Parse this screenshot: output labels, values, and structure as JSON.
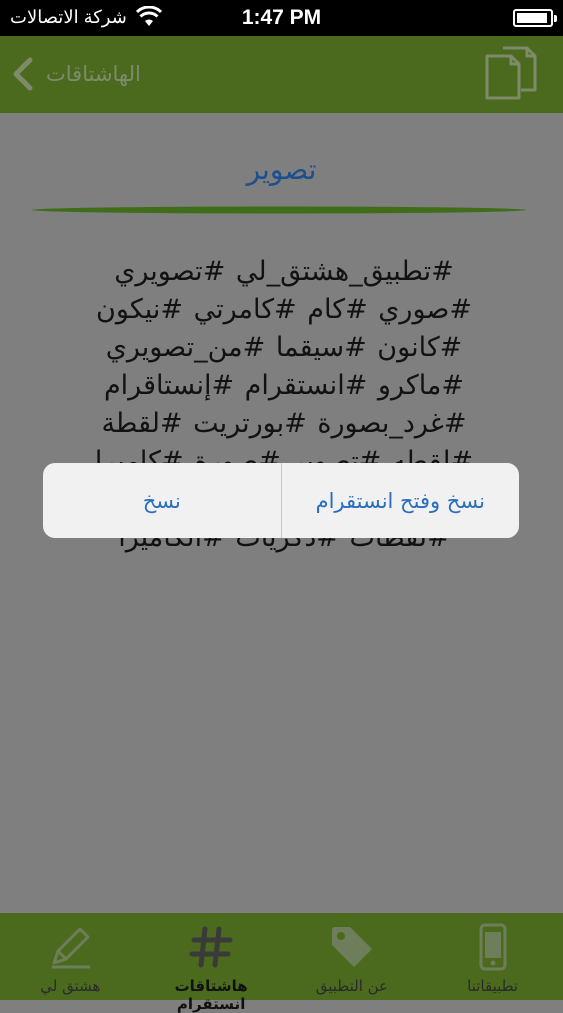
{
  "status_bar": {
    "carrier": "شركة الاتصالات",
    "time": "1:47 PM",
    "battery_level": 0.95
  },
  "nav_bar": {
    "back_label": "الهاشتاقات",
    "action_icon": "copy-icon"
  },
  "page": {
    "title": "تصوير",
    "hashtags": "#تطبيق_هشتق_لي #تصويري #صوري #كام #كامرتي #نيكون #كانون #سيقما #من_تصويري #ماكرو #انستقرام #إنستاقرام #غرد_بصورة #بورتريت #لقطة #لقطه #تصوير #صورة #كاميرا #عدستي #عدسة #فوتوغرافي #لقطات #ذكريات #الكاميرا"
  },
  "action_sheet": {
    "copy_open_label": "نسخ وفتح انستقرام",
    "copy_label": "نسخ"
  },
  "tab_bar": {
    "items": [
      {
        "label": "تطبيقاتنا",
        "icon": "phone-icon",
        "active": false
      },
      {
        "label": "عن التطبيق",
        "icon": "tag-icon",
        "active": false
      },
      {
        "label": "هاشتاقات انستقرام",
        "icon": "hashtag-icon",
        "active": true
      },
      {
        "label": "هشتق لي",
        "icon": "pencil-icon",
        "active": false
      }
    ]
  },
  "colors": {
    "bar_green": "#4b6a1e",
    "overlay_gray": "#7f7f80",
    "link_blue": "#2a6fbd",
    "title_blue": "#1c4f8c"
  }
}
